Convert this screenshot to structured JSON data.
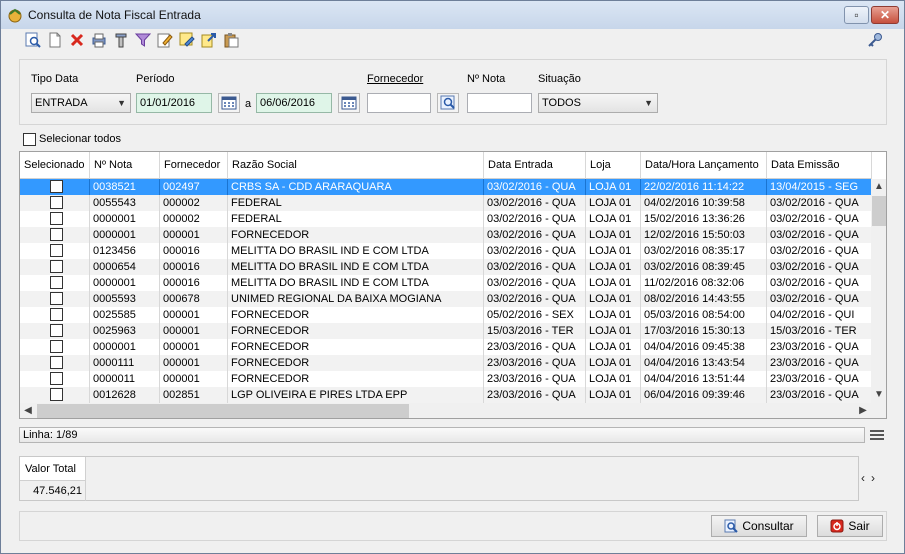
{
  "window": {
    "title": "Consulta de Nota Fiscal Entrada"
  },
  "toolbar": {
    "icons": [
      "search-document-icon",
      "new-document-icon",
      "delete-icon",
      "print-icon",
      "tools-icon",
      "filter-icon",
      "edit-icon",
      "edit-note-icon",
      "export-icon",
      "clipboard-icon"
    ]
  },
  "filters": {
    "tipo_data_label": "Tipo Data",
    "tipo_data_value": "ENTRADA",
    "periodo_label": "Período",
    "periodo_start": "01/01/2016",
    "periodo_sep": "a",
    "periodo_end": "06/06/2016",
    "fornecedor_label": "Fornecedor",
    "fornecedor_value": "",
    "nota_label": "Nº Nota",
    "nota_value": "",
    "situacao_label": "Situação",
    "situacao_value": "TODOS"
  },
  "select_all_label": "Selecionar todos",
  "grid": {
    "columns": [
      "Selecionado",
      "Nº Nota",
      "Fornecedor",
      "Razão Social",
      "Data Entrada",
      "Loja",
      "Data/Hora Lançamento",
      "Data Emissão"
    ],
    "rows": [
      [
        "0038521",
        "002497",
        "CRBS SA - CDD ARARAQUARA",
        "03/02/2016 - QUA",
        "LOJA 01",
        "22/02/2016 11:14:22",
        "13/04/2015 - SEG"
      ],
      [
        "0055543",
        "000002",
        "FEDERAL",
        "03/02/2016 - QUA",
        "LOJA 01",
        "04/02/2016 10:39:58",
        "03/02/2016 - QUA"
      ],
      [
        "0000001",
        "000002",
        "FEDERAL",
        "03/02/2016 - QUA",
        "LOJA 01",
        "15/02/2016 13:36:26",
        "03/02/2016 - QUA"
      ],
      [
        "0000001",
        "000001",
        "FORNECEDOR",
        "03/02/2016 - QUA",
        "LOJA 01",
        "12/02/2016 15:50:03",
        "03/02/2016 - QUA"
      ],
      [
        "0123456",
        "000016",
        "MELITTA DO BRASIL IND E COM LTDA",
        "03/02/2016 - QUA",
        "LOJA 01",
        "03/02/2016 08:35:17",
        "03/02/2016 - QUA"
      ],
      [
        "0000654",
        "000016",
        "MELITTA DO BRASIL IND E COM LTDA",
        "03/02/2016 - QUA",
        "LOJA 01",
        "03/02/2016 08:39:45",
        "03/02/2016 - QUA"
      ],
      [
        "0000001",
        "000016",
        "MELITTA DO BRASIL IND E COM LTDA",
        "03/02/2016 - QUA",
        "LOJA 01",
        "11/02/2016 08:32:06",
        "03/02/2016 - QUA"
      ],
      [
        "0005593",
        "000678",
        "UNIMED REGIONAL DA BAIXA MOGIANA",
        "03/02/2016 - QUA",
        "LOJA 01",
        "08/02/2016 14:43:55",
        "03/02/2016 - QUA"
      ],
      [
        "0025585",
        "000001",
        "FORNECEDOR",
        "05/02/2016 - SEX",
        "LOJA 01",
        "05/03/2016 08:54:00",
        "04/02/2016 - QUI"
      ],
      [
        "0025963",
        "000001",
        "FORNECEDOR",
        "15/03/2016 - TER",
        "LOJA 01",
        "17/03/2016 15:30:13",
        "15/03/2016 - TER"
      ],
      [
        "0000001",
        "000001",
        "FORNECEDOR",
        "23/03/2016 - QUA",
        "LOJA 01",
        "04/04/2016 09:45:38",
        "23/03/2016 - QUA"
      ],
      [
        "0000111",
        "000001",
        "FORNECEDOR",
        "23/03/2016 - QUA",
        "LOJA 01",
        "04/04/2016 13:43:54",
        "23/03/2016 - QUA"
      ],
      [
        "0000011",
        "000001",
        "FORNECEDOR",
        "23/03/2016 - QUA",
        "LOJA 01",
        "04/04/2016 13:51:44",
        "23/03/2016 - QUA"
      ],
      [
        "0012628",
        "002851",
        "LGP OLIVEIRA E PIRES LTDA EPP",
        "23/03/2016 - QUA",
        "LOJA 01",
        "06/04/2016 09:39:46",
        "23/03/2016 - QUA"
      ]
    ]
  },
  "status": {
    "linha": "Linha: 1/89"
  },
  "totals": {
    "label": "Valor Total",
    "value": "47.546,21"
  },
  "buttons": {
    "consultar": "Consultar",
    "sair": "Sair"
  },
  "colors": {
    "selection": "#3399ff",
    "date_field": "#dff5e8",
    "close_red": "#c6503d"
  }
}
